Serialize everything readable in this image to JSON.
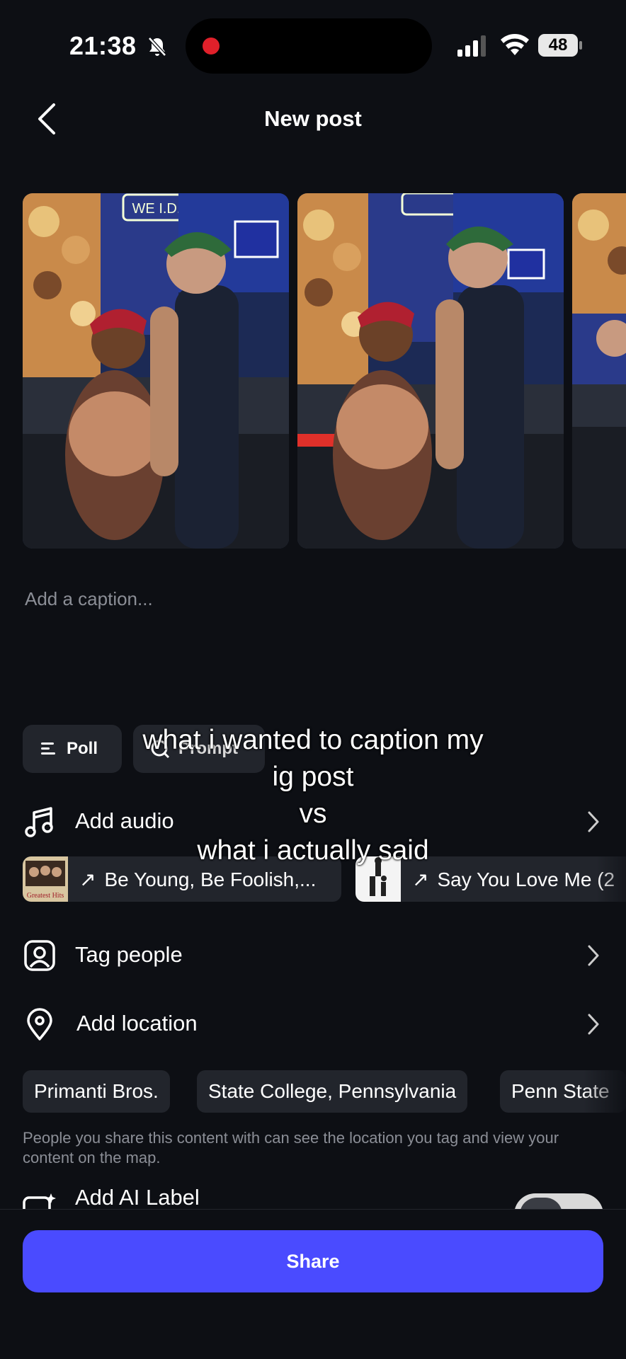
{
  "status_bar": {
    "time": "21:38",
    "battery": "48",
    "icons": [
      "bell-slash-icon",
      "recording-dot-icon",
      "cellular-signal-icon",
      "wifi-icon",
      "battery-icon"
    ]
  },
  "header": {
    "title": "New post",
    "back_icon": "chevron-left-icon"
  },
  "carousel": {
    "photos": [
      {
        "name": "photo-1"
      },
      {
        "name": "photo-2"
      },
      {
        "name": "photo-3"
      }
    ],
    "sign_text": "WE I.D."
  },
  "caption": {
    "placeholder": "Add a caption..."
  },
  "chips": {
    "poll": "Poll",
    "prompt": "Prompt"
  },
  "overlay_text": {
    "line1": "what i wanted to caption my",
    "line2": "ig post",
    "line3": "vs",
    "line4": "what i actually said"
  },
  "audio": {
    "label": "Add audio",
    "suggestions": [
      {
        "title": "Be Young, Be Foolish,...",
        "thumb_text": "Greatest Hits"
      },
      {
        "title": "Say You Love Me (2"
      }
    ]
  },
  "tag_people": {
    "label": "Tag people"
  },
  "location": {
    "label": "Add location",
    "suggestions": [
      "Primanti Bros.",
      "State College, Pennsylvania",
      "Penn State"
    ],
    "note": "People you share this content with can see the location you tag and view your content on the map."
  },
  "ai_label": {
    "label": "Add AI Label"
  },
  "share_button": "Share",
  "colors": {
    "background": "#0d0f14",
    "chip": "#22252c",
    "accent": "#4a4bff",
    "muted_text": "#8b8e96"
  }
}
